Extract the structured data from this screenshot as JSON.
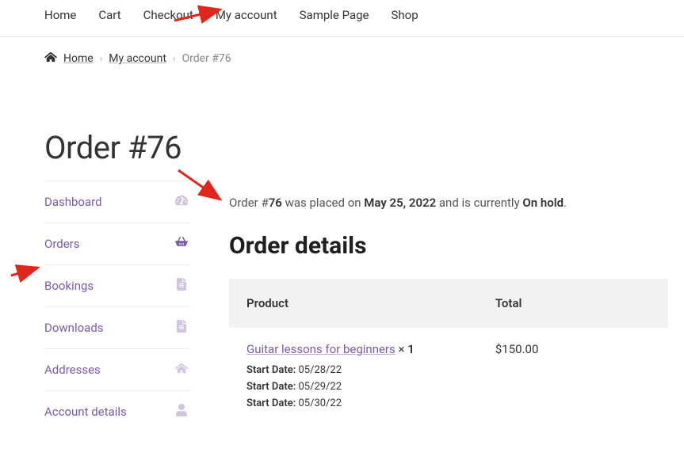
{
  "topnav": {
    "items": [
      {
        "label": "Home"
      },
      {
        "label": "Cart"
      },
      {
        "label": "Checkout"
      },
      {
        "label": "My account"
      },
      {
        "label": "Sample Page"
      },
      {
        "label": "Shop"
      }
    ]
  },
  "breadcrumb": {
    "home": "Home",
    "myaccount": "My account",
    "current": "Order #76"
  },
  "page_title": "Order #76",
  "sidenav": {
    "items": [
      {
        "label": "Dashboard",
        "icon": "dashboard"
      },
      {
        "label": "Orders",
        "icon": "basket",
        "active": true
      },
      {
        "label": "Bookings",
        "icon": "file"
      },
      {
        "label": "Downloads",
        "icon": "file"
      },
      {
        "label": "Addresses",
        "icon": "home"
      },
      {
        "label": "Account details",
        "icon": "user"
      }
    ]
  },
  "status": {
    "prefix": "Order #",
    "number": "76",
    "middle1": " was placed on ",
    "date": "May 25, 2022",
    "middle2": " and is currently ",
    "state": "On hold",
    "suffix": "."
  },
  "details": {
    "title": "Order details",
    "headers": {
      "product": "Product",
      "total": "Total"
    },
    "row": {
      "name": "Guitar lessons for beginners",
      "qty_prefix": " × ",
      "qty": "1",
      "meta_label": "Start Date:",
      "dates": [
        "05/28/22",
        "05/29/22",
        "05/30/22"
      ],
      "total": "$150.00"
    }
  }
}
